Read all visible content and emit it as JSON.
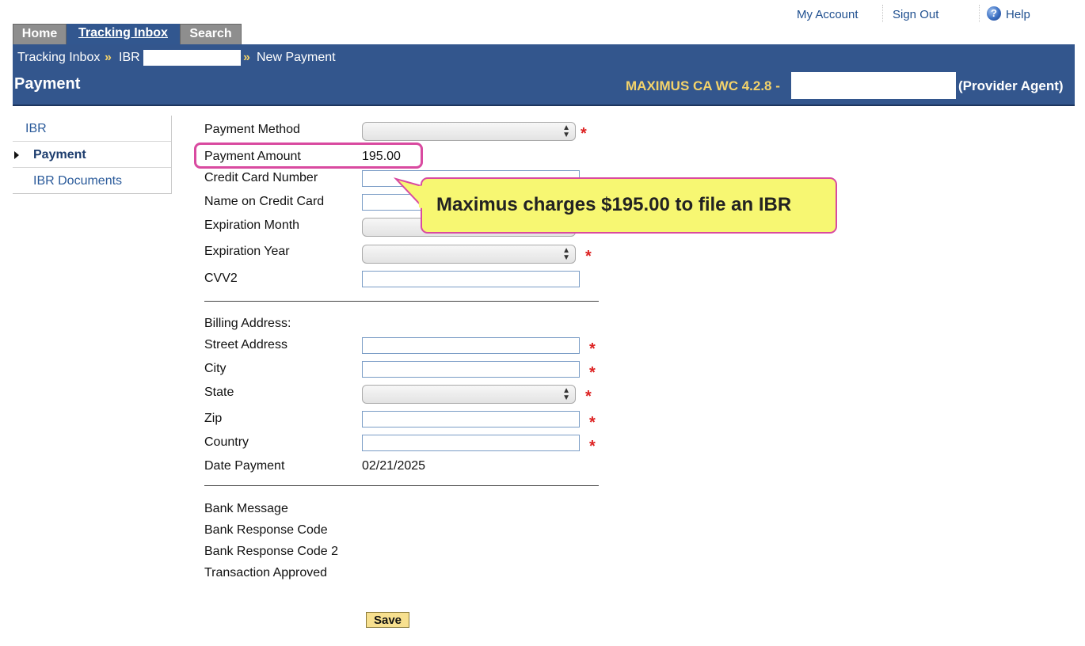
{
  "top_links": {
    "my_account": "My Account",
    "sign_out": "Sign Out",
    "help": "Help"
  },
  "tabs": [
    {
      "label": "Home"
    },
    {
      "label": "Tracking Inbox",
      "active": true
    },
    {
      "label": "Search"
    }
  ],
  "breadcrumb": {
    "item1": "Tracking Inbox",
    "sep": "»",
    "item2": "IBR",
    "item3": "New Payment"
  },
  "header": {
    "page_title": "Payment",
    "version": "MAXIMUS CA WC 4.2.8 -",
    "role": "(Provider Agent)"
  },
  "sidebar": {
    "items": [
      {
        "label": "IBR"
      },
      {
        "label": "Payment",
        "active": true
      },
      {
        "label": "IBR Documents"
      }
    ]
  },
  "form": {
    "payment_method": {
      "label": "Payment Method",
      "value": ""
    },
    "payment_amount": {
      "label": "Payment Amount",
      "value": "195.00"
    },
    "credit_card_number": {
      "label": "Credit Card Number",
      "value": ""
    },
    "name_on_card": {
      "label": "Name on Credit Card",
      "value": ""
    },
    "expiration_month": {
      "label": "Expiration Month",
      "value": ""
    },
    "expiration_year": {
      "label": "Expiration Year",
      "value": ""
    },
    "cvv2": {
      "label": "CVV2",
      "value": ""
    },
    "billing_address_heading": "Billing Address:",
    "street_address": {
      "label": "Street Address",
      "value": ""
    },
    "city": {
      "label": "City",
      "value": ""
    },
    "state": {
      "label": "State",
      "value": ""
    },
    "zip": {
      "label": "Zip",
      "value": ""
    },
    "country": {
      "label": "Country",
      "value": ""
    },
    "date_payment": {
      "label": "Date Payment",
      "value": "02/21/2025"
    },
    "bank_message": {
      "label": "Bank Message"
    },
    "bank_response_code": {
      "label": "Bank Response Code"
    },
    "bank_response_code_2": {
      "label": "Bank Response Code 2"
    },
    "transaction_approved": {
      "label": "Transaction Approved"
    },
    "required_marker": "*",
    "save_label": "Save"
  },
  "callout": {
    "text": "Maximus charges $195.00 to file an IBR"
  },
  "colors": {
    "header_bar": "#33568d",
    "version_text": "#f4d36a",
    "highlight_border": "#d94aa0",
    "callout_fill": "#f7f772",
    "required": "#dd2222",
    "save_button": "#f7e08f"
  }
}
